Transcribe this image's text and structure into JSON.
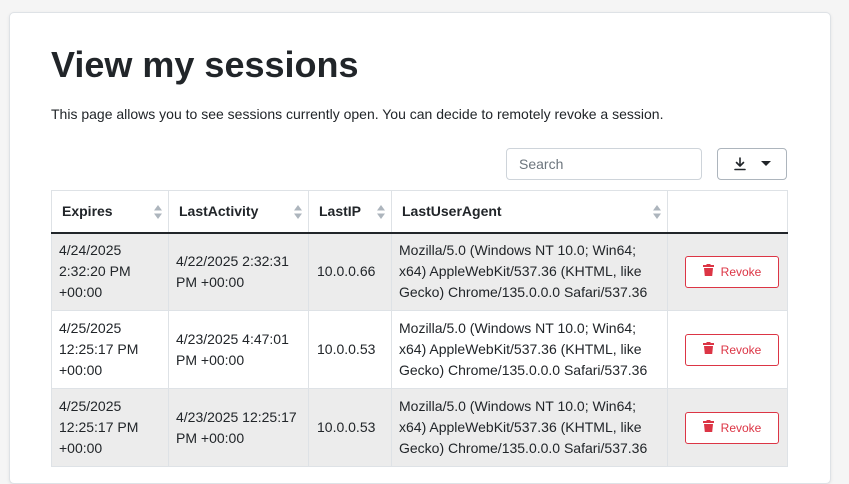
{
  "page": {
    "title": "View my sessions",
    "intro": "This page allows you to see sessions currently open. You can decide to remotely revoke a session."
  },
  "toolbar": {
    "search_placeholder": "Search",
    "export_icon": "download-icon",
    "dropdown_icon": "caret-down-icon"
  },
  "table": {
    "columns": [
      "Expires",
      "LastActivity",
      "LastIP",
      "LastUserAgent",
      ""
    ],
    "rows": [
      {
        "expires": "4/24/2025 2:32:20 PM +00:00",
        "last_activity": "4/22/2025 2:32:31 PM +00:00",
        "last_ip": "10.0.0.66",
        "user_agent": "Mozilla/5.0 (Windows NT 10.0; Win64; x64) AppleWebKit/537.36 (KHTML, like Gecko) Chrome/135.0.0.0 Safari/537.36",
        "action_label": "Revoke"
      },
      {
        "expires": "4/25/2025 12:25:17 PM +00:00",
        "last_activity": "4/23/2025 4:47:01 PM +00:00",
        "last_ip": "10.0.0.53",
        "user_agent": "Mozilla/5.0 (Windows NT 10.0; Win64; x64) AppleWebKit/537.36 (KHTML, like Gecko) Chrome/135.0.0.0 Safari/537.36",
        "action_label": "Revoke"
      },
      {
        "expires": "4/25/2025 12:25:17 PM +00:00",
        "last_activity": "4/23/2025 12:25:17 PM +00:00",
        "last_ip": "10.0.0.53",
        "user_agent": "Mozilla/5.0 (Windows NT 10.0; Win64; x64) AppleWebKit/537.36 (KHTML, like Gecko) Chrome/135.0.0.0 Safari/537.36",
        "action_label": "Revoke"
      }
    ]
  },
  "colors": {
    "danger": "#dc3545",
    "striped_row": "#ececec"
  }
}
